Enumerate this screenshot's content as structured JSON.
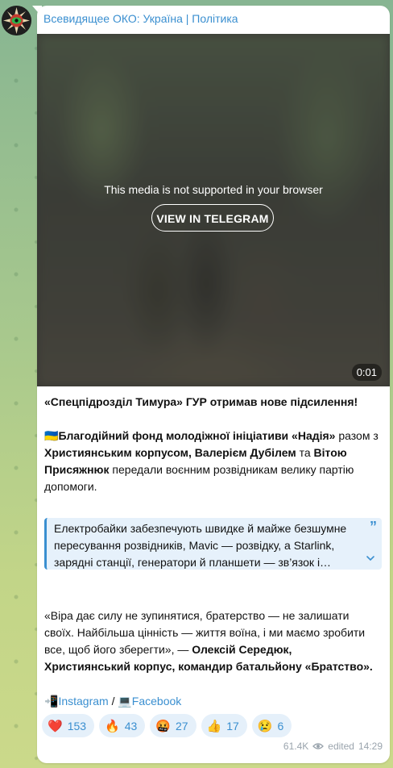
{
  "channel": {
    "title": "Всевидящее ОКО: Україна | Політика"
  },
  "media": {
    "message": "This media is not supported in your browser",
    "button_label": "VIEW IN TELEGRAM",
    "duration": "0:01"
  },
  "post": {
    "headline": "«Спецпідрозділ Тимура» ГУР отримав нове підсилення!",
    "p2_flag": "🇺🇦",
    "p2_a": "Благодійний фонд молодіжної ініціативи «Надія»",
    "p2_b": " разом з ",
    "p2_c": "Християнським корпусом, Валерієм Дубілем",
    "p2_d": " та ",
    "p2_e": "Вітою Присяжнюк",
    "p2_f": " передали воєнним розвідникам велику партію допомоги.",
    "quote": "Електробайки забезпечують швидке й майже безшумне пересування розвідників, Mavic — розвідку, а Starlink, зарядні станції, генератори й планшети — зв’язок і…",
    "p3_a": "«Віра дає силу не зупинятися, братерство — не залишати своїх. Найбільша цінність — життя воїна, і ми маємо зробити все, щоб його зберегти», — ",
    "p3_b": "Олексій Середюк, Християнський корпус, командир батальйону «Братство».",
    "links_prefix_icon": "📲",
    "link_instagram": "Instagram",
    "links_sep": " / ",
    "links_laptop_icon": "💻",
    "link_facebook": "Facebook"
  },
  "reactions": [
    {
      "emoji": "❤️",
      "count": "153"
    },
    {
      "emoji": "🔥",
      "count": "43"
    },
    {
      "emoji": "🤬",
      "count": "27"
    },
    {
      "emoji": "👍",
      "count": "17"
    },
    {
      "emoji": "😢",
      "count": "6"
    }
  ],
  "meta": {
    "views": "61.4K",
    "edited": "edited",
    "time": "14:29"
  },
  "colors": {
    "accent": "#3a8fd0",
    "quote_bg": "#e6f1fb"
  }
}
